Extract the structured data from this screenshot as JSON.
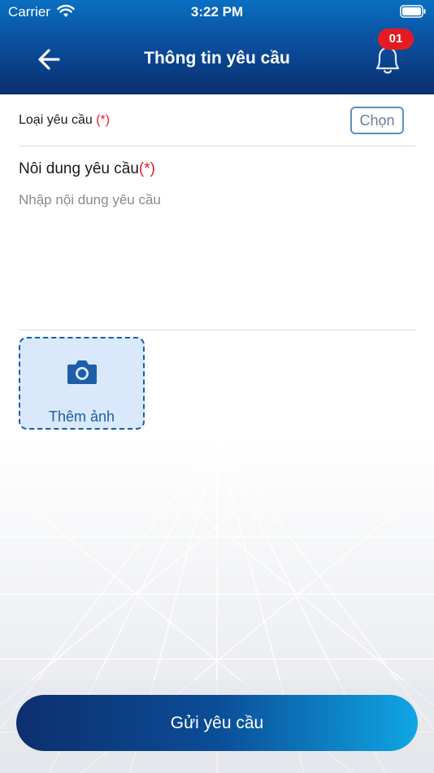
{
  "status_bar": {
    "carrier": "Carrier",
    "time": "3:22 PM"
  },
  "header": {
    "title": "Thông tin yêu cầu",
    "notification_count": "01"
  },
  "form": {
    "request_type_label": "Loại yêu cầu ",
    "request_type_required": "(*)",
    "choose_label": "Chọn",
    "content_label": "Nôi dung yêu cầu",
    "content_required": "(*)",
    "content_placeholder": "Nhập nội dung yêu cầu",
    "content_value": "",
    "add_photo_label": "Thêm ảnh"
  },
  "footer": {
    "submit_label": "Gửi yêu cầu"
  },
  "colors": {
    "header_top": "#0a6fc2",
    "header_bottom": "#0a2f6e",
    "required": "#e51b23",
    "badge": "#e51b23",
    "accent": "#1d5ea8",
    "button_start": "#0d2f6e",
    "button_end": "#0fa6e5"
  },
  "icons": {
    "back": "arrow-left-icon",
    "bell": "bell-icon",
    "camera": "camera-icon",
    "wifi": "wifi-icon",
    "battery": "battery-icon"
  }
}
